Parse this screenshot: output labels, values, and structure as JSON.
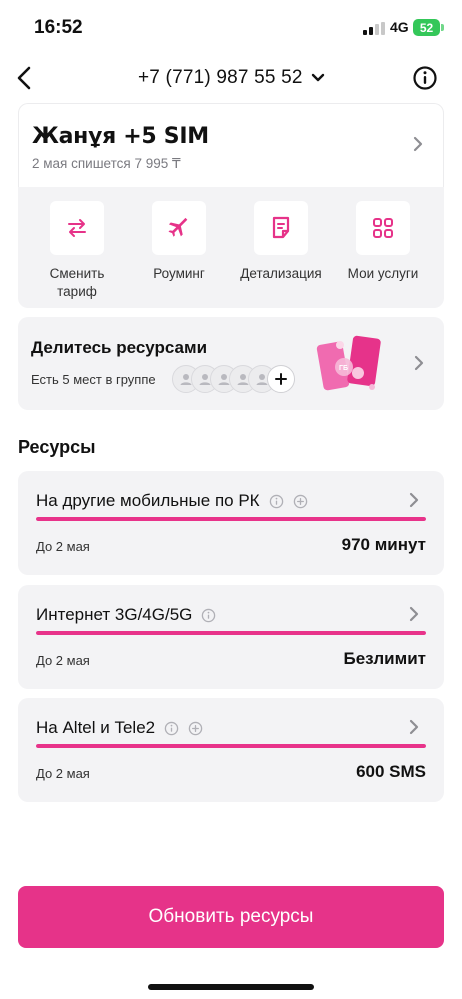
{
  "status_bar": {
    "time": "16:52",
    "network": "4G",
    "battery": "52",
    "battery_color": "#34c759"
  },
  "header": {
    "phone_number": "+7 (771) 987 55 52",
    "back_icon": "chevron-left-icon",
    "dropdown_icon": "chevron-down-icon",
    "info_icon": "info-circle-icon"
  },
  "tariff": {
    "name": "Жанұя +5 SIM",
    "subtitle": "2 мая спишется 7 995 ₸",
    "actions": [
      {
        "label": "Сменить тариф",
        "icon": "swap-arrows-icon"
      },
      {
        "label": "Роуминг",
        "icon": "airplane-icon"
      },
      {
        "label": "Детализация",
        "icon": "document-icon"
      },
      {
        "label": "Мои услуги",
        "icon": "grid-icon"
      }
    ]
  },
  "share": {
    "title": "Делитесь ресурсами",
    "subtitle": "Есть 5 мест в группе",
    "slots": 5,
    "art_label": "ГБ"
  },
  "resources": {
    "title": "Ресурсы",
    "items": [
      {
        "title": "На другие мобильные по РК",
        "until": "До 2 мая",
        "amount": "970 минут",
        "progress": 1.0,
        "has_plus": true
      },
      {
        "title": "Интернет 3G/4G/5G",
        "until": "До 2 мая",
        "amount": "Безлимит",
        "progress": 1.0,
        "has_plus": false
      },
      {
        "title": "На Altel и Tele2",
        "until": "До 2 мая",
        "amount": "600 SMS",
        "progress": 1.0,
        "has_plus": true
      }
    ]
  },
  "footer": {
    "refresh_label": "Обновить ресурсы"
  },
  "colors": {
    "accent": "#e63389",
    "card_bg": "#f3f3f5"
  }
}
